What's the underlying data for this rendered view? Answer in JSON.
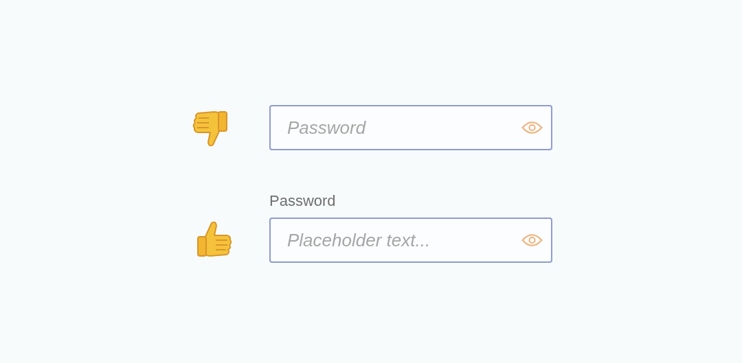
{
  "rows": [
    {
      "kind": "bad",
      "placeholder": "Password"
    },
    {
      "kind": "good",
      "label": "Password",
      "placeholder": "Placeholder text..."
    }
  ]
}
